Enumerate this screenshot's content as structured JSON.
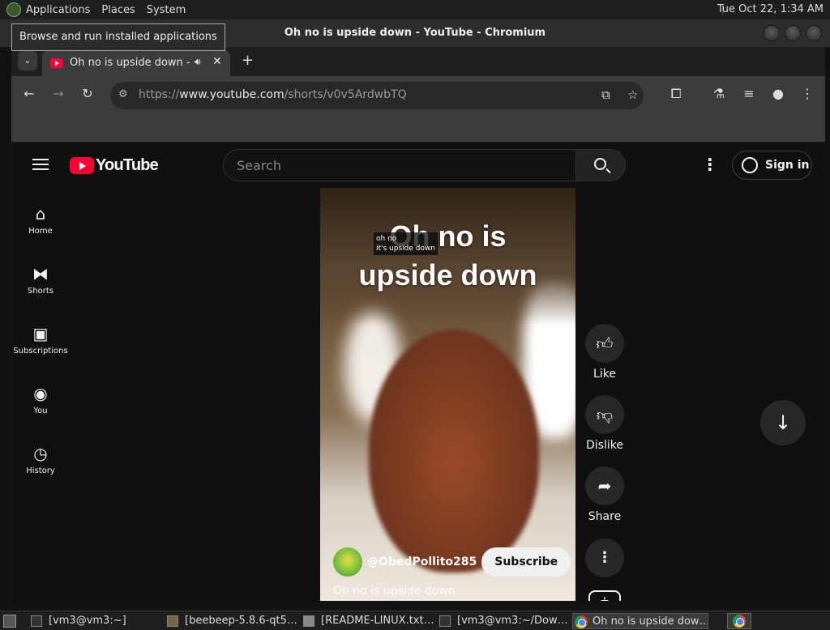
{
  "top_panel": {
    "menus": [
      "Applications",
      "Places",
      "System"
    ],
    "clock": "Tue Oct 22,  1:34 AM"
  },
  "tooltip": "Browse and run installed applications",
  "window": {
    "title": "Oh no is upside down - YouTube - Chromium"
  },
  "browser": {
    "tab": {
      "title": "Oh no is upside down - YouTube",
      "favicon": "youtube-icon",
      "audio_icon": "speaker-icon"
    },
    "url_scheme": "https://",
    "url_host": "www.youtube.com",
    "url_path": "/shorts/v0v5ArdwbTQ"
  },
  "youtube": {
    "logo_text": "YouTube",
    "search_placeholder": "Search",
    "sign_in": "Sign in",
    "guide": [
      {
        "label": "Home",
        "icon": "home-icon"
      },
      {
        "label": "Shorts",
        "icon": "shorts-icon"
      },
      {
        "label": "Subscriptions",
        "icon": "subscriptions-icon"
      },
      {
        "label": "You",
        "icon": "you-icon"
      },
      {
        "label": "History",
        "icon": "history-icon"
      }
    ],
    "short": {
      "overlay_line1": "Oh no is",
      "overlay_line2": "upside down",
      "caption_line1": "oh no",
      "caption_line2": "it's upside down",
      "channel": "@ObedPollito285",
      "subscribe": "Subscribe",
      "title": "Oh no is upside down"
    },
    "actions": {
      "like": "Like",
      "dislike": "Dislike",
      "share": "Share"
    }
  },
  "taskbar": {
    "tasks": [
      {
        "label": "[vm3@vm3:~]",
        "icon": "terminal-icon"
      },
      {
        "label": "[beebeep-5.8.6-qt5…",
        "icon": "folder-icon"
      },
      {
        "label": "[README-LINUX.txt…",
        "icon": "text-file-icon"
      },
      {
        "label": "[vm3@vm3:~/Dow…",
        "icon": "terminal-icon"
      },
      {
        "label": "Oh no is upside dow…",
        "icon": "chromium-icon"
      }
    ]
  },
  "colors": {
    "youtube_red": "#ff0033",
    "page_bg": "#0f0f0f",
    "browser_toolbar": "#3c3c3c"
  }
}
